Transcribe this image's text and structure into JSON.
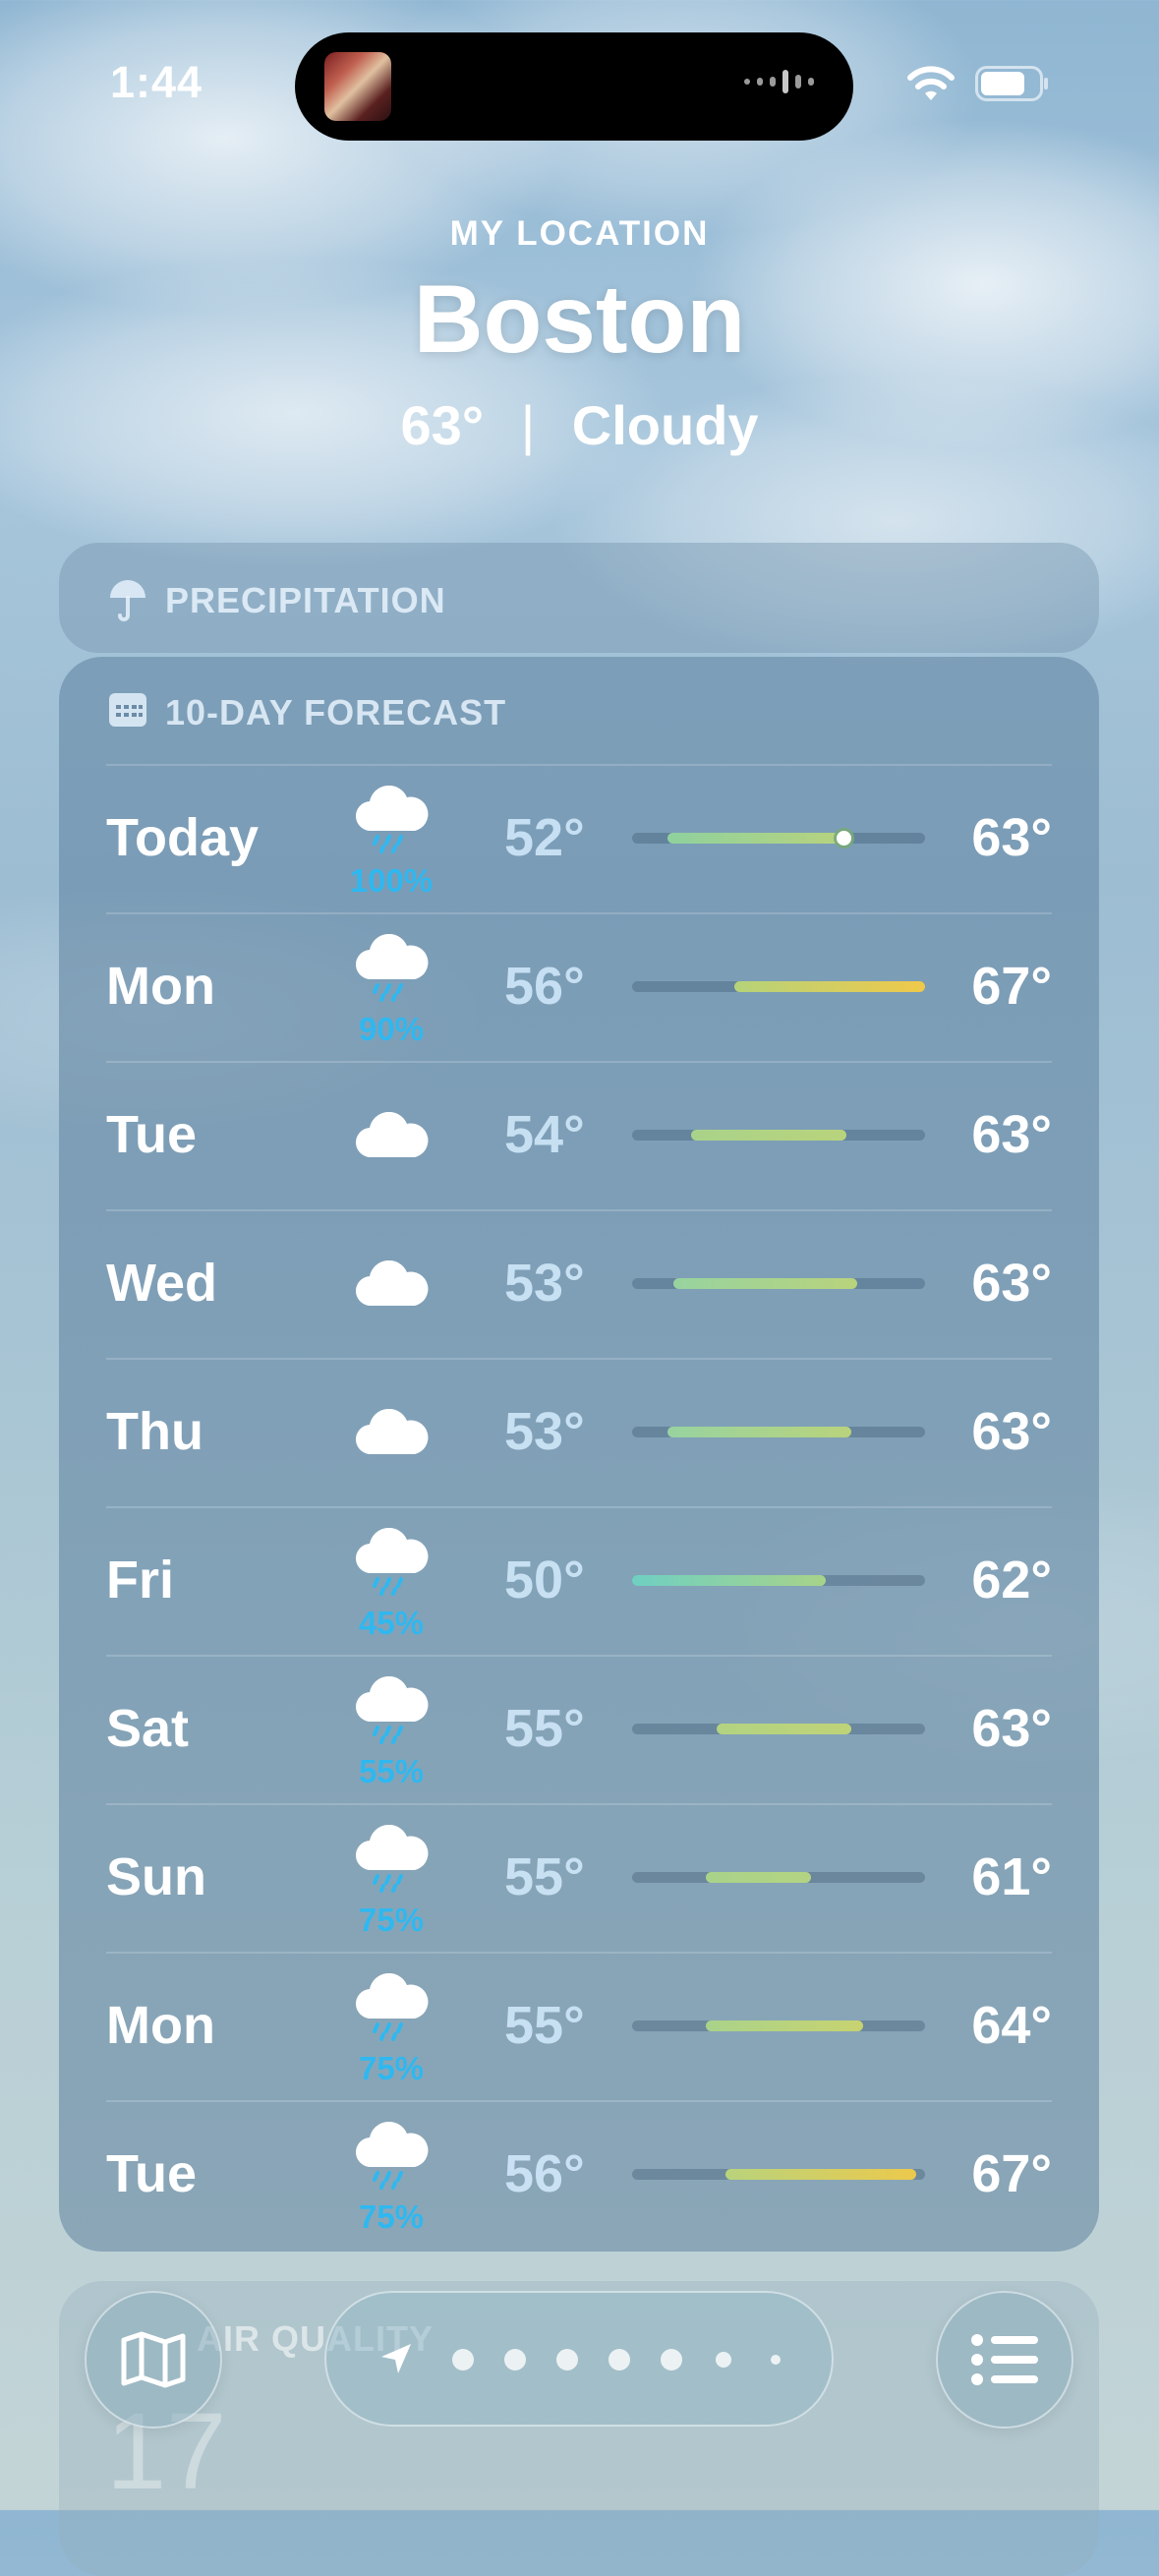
{
  "status": {
    "time": "1:44",
    "icons": [
      "now-playing-art",
      "audio-waveform-icon",
      "wifi-icon",
      "battery-icon"
    ]
  },
  "header": {
    "location_label": "MY LOCATION",
    "city": "Boston",
    "temperature": "63°",
    "separator": "|",
    "condition": "Cloudy"
  },
  "precipitation": {
    "title": "PRECIPITATION",
    "icon": "umbrella-icon"
  },
  "forecast": {
    "title": "10-DAY FORECAST",
    "icon": "calendar-icon",
    "days": [
      {
        "day": "Today",
        "icon": "cloud-rain-icon",
        "precip": "100%",
        "low": "52°",
        "high": "63°",
        "bar": [
          0.12,
          0.75
        ],
        "current": 0.72,
        "c1": "#8fd19e",
        "c2": "#b9d37c"
      },
      {
        "day": "Mon",
        "icon": "cloud-rain-icon",
        "precip": "90%",
        "low": "56°",
        "high": "67°",
        "bar": [
          0.35,
          1.0
        ],
        "c1": "#b5d37a",
        "c2": "#f0c94a"
      },
      {
        "day": "Tue",
        "icon": "cloud-icon",
        "precip": "",
        "low": "54°",
        "high": "63°",
        "bar": [
          0.2,
          0.73
        ],
        "c1": "#a9d38a",
        "c2": "#b9d37c"
      },
      {
        "day": "Wed",
        "icon": "cloud-icon",
        "precip": "",
        "low": "53°",
        "high": "63°",
        "bar": [
          0.14,
          0.77
        ],
        "c1": "#97d3a0",
        "c2": "#b9d37c"
      },
      {
        "day": "Thu",
        "icon": "cloud-icon",
        "precip": "",
        "low": "53°",
        "high": "63°",
        "bar": [
          0.12,
          0.75
        ],
        "c1": "#97d3a0",
        "c2": "#b9d37c"
      },
      {
        "day": "Fri",
        "icon": "cloud-rain-icon",
        "precip": "45%",
        "low": "50°",
        "high": "62°",
        "bar": [
          0.0,
          0.66
        ],
        "c1": "#6fd0c2",
        "c2": "#a8d38a"
      },
      {
        "day": "Sat",
        "icon": "cloud-rain-icon",
        "precip": "55%",
        "low": "55°",
        "high": "63°",
        "bar": [
          0.29,
          0.75
        ],
        "c1": "#b3d382",
        "c2": "#bfd378"
      },
      {
        "day": "Sun",
        "icon": "cloud-rain-icon",
        "precip": "75%",
        "low": "55°",
        "high": "61°",
        "bar": [
          0.25,
          0.61
        ],
        "c1": "#a9d38a",
        "c2": "#b3d382"
      },
      {
        "day": "Mon",
        "icon": "cloud-rain-icon",
        "precip": "75%",
        "low": "55°",
        "high": "64°",
        "bar": [
          0.25,
          0.79
        ],
        "c1": "#a9d38a",
        "c2": "#c8d370"
      },
      {
        "day": "Tue",
        "icon": "cloud-rain-icon",
        "precip": "75%",
        "low": "56°",
        "high": "67°",
        "bar": [
          0.32,
          0.97
        ],
        "c1": "#b9d37c",
        "c2": "#ecc94c"
      }
    ]
  },
  "air_quality": {
    "title": "AIR QUALITY",
    "value": "17"
  },
  "bottom_bar": {
    "map_icon": "map-icon",
    "location_icon": "location-arrow-icon",
    "page_dots": 7,
    "list_icon": "list-icon"
  }
}
